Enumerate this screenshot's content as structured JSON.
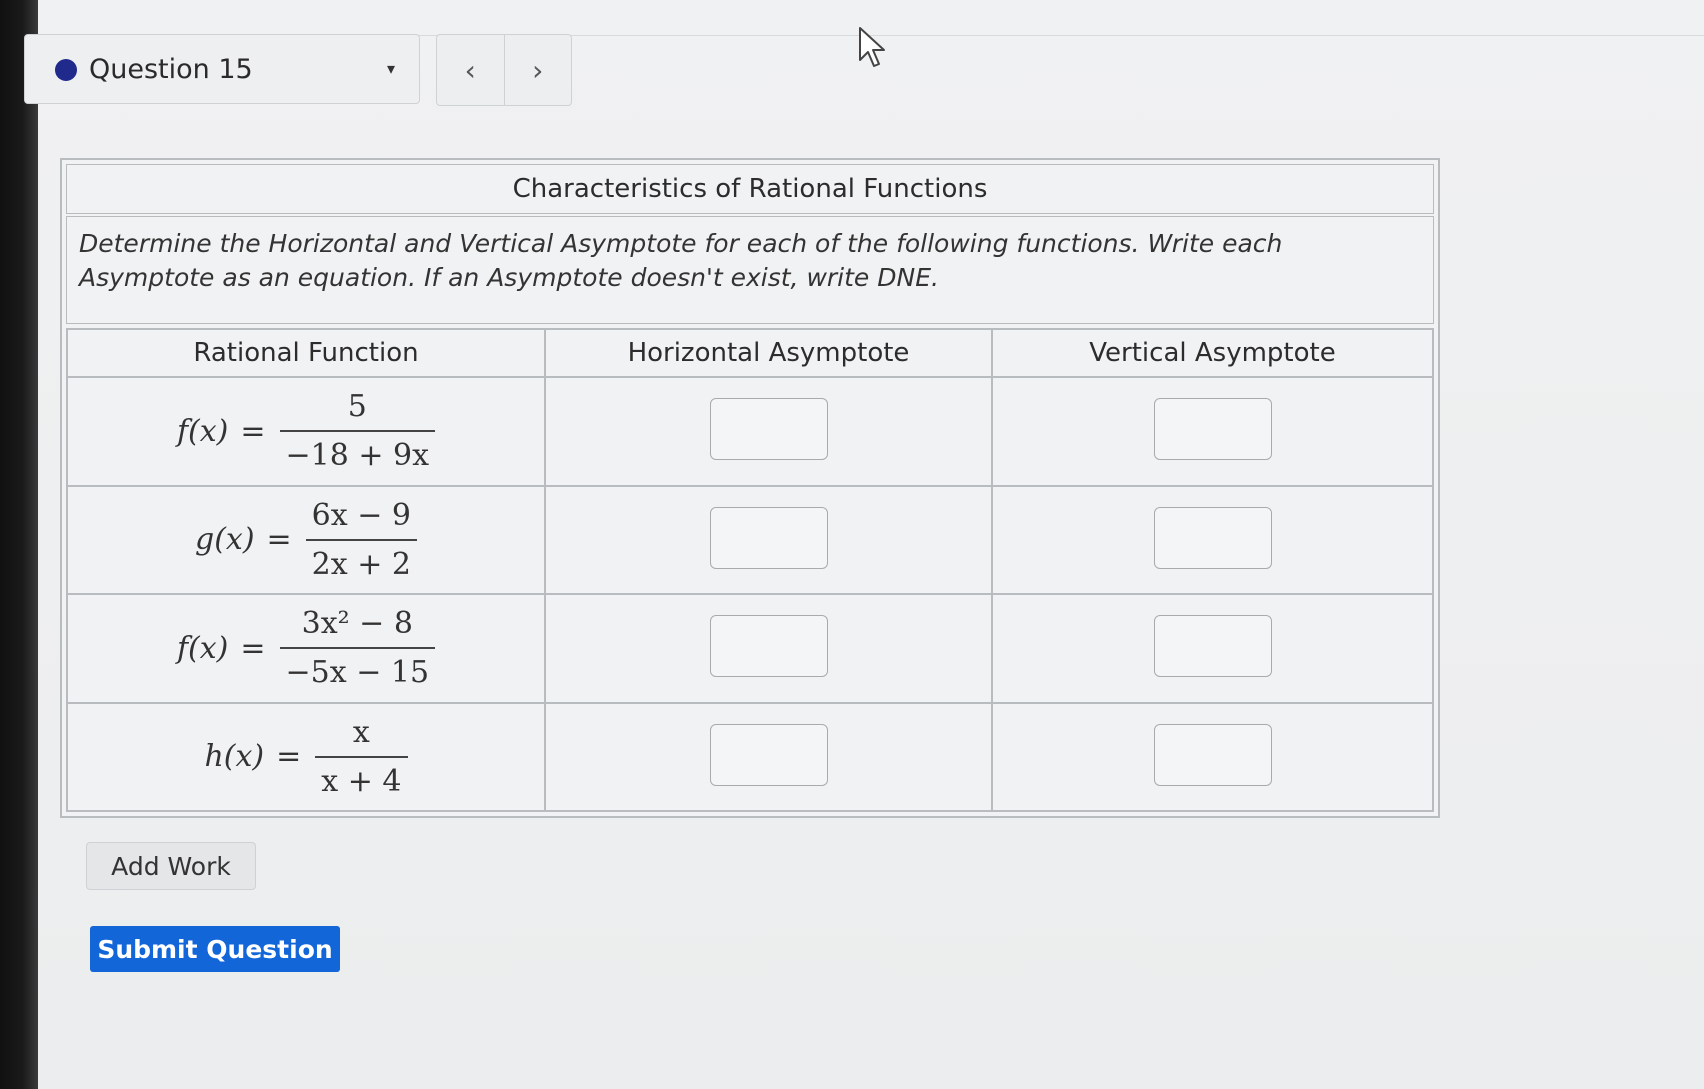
{
  "header": {
    "question_label": "Question 15",
    "prev_glyph": "‹",
    "next_glyph": "›",
    "caret": "▾"
  },
  "card": {
    "title": "Characteristics of Rational Functions",
    "instructions": "Determine the Horizontal and Vertical Asymptote for each of the following functions. Write each Asymptote as an equation. If an Asymptote doesn't exist, write DNE.",
    "columns": [
      "Rational Function",
      "Horizontal Asymptote",
      "Vertical Asymptote"
    ],
    "rows": [
      {
        "lhs": "f(x)",
        "eq": "=",
        "num": "5",
        "den": "−18 + 9x"
      },
      {
        "lhs": "g(x)",
        "eq": "=",
        "num": "6x − 9",
        "den": "2x + 2"
      },
      {
        "lhs": "f(x)",
        "eq": "=",
        "num": "3x² − 8",
        "den": "−5x − 15"
      },
      {
        "lhs": "h(x)",
        "eq": "=",
        "num": "x",
        "den": "x + 4"
      }
    ]
  },
  "actions": {
    "add_work": "Add Work",
    "submit": "Submit Question"
  },
  "colors": {
    "accent": "#1266d8",
    "dot": "#1f2a8c"
  }
}
